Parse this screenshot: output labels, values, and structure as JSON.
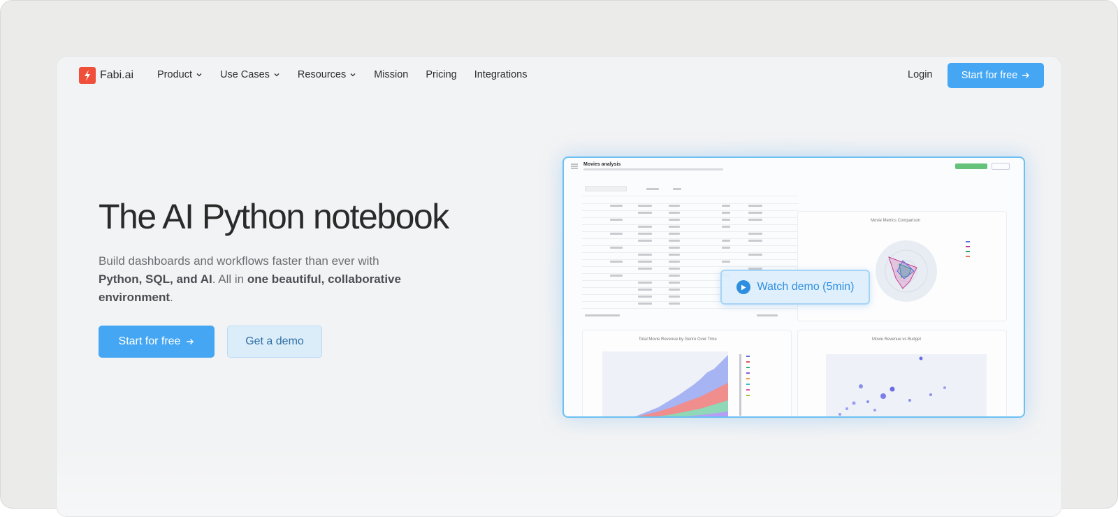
{
  "brand": {
    "name": "Fabi.ai"
  },
  "nav": {
    "items": [
      {
        "label": "Product",
        "has_dropdown": true
      },
      {
        "label": "Use Cases",
        "has_dropdown": true
      },
      {
        "label": "Resources",
        "has_dropdown": true
      },
      {
        "label": "Mission",
        "has_dropdown": false
      },
      {
        "label": "Pricing",
        "has_dropdown": false
      },
      {
        "label": "Integrations",
        "has_dropdown": false
      }
    ],
    "login": "Login",
    "cta": "Start for free"
  },
  "hero": {
    "title": "The AI Python notebook",
    "subtitle_part1": "Build dashboards and workflows faster than ever with ",
    "subtitle_bold1": "Python, SQL, and AI",
    "subtitle_part2": ". All in ",
    "subtitle_bold2": "one beautiful, collaborative environment",
    "subtitle_part3": ".",
    "primary_button": "Start for free",
    "secondary_button": "Get a demo"
  },
  "preview": {
    "notebook_title": "Movies analysis",
    "panel_radar_title": "Movie Metrics Comparison",
    "panel_bar_title": "Total Movie Revenue by Genre Over Time",
    "panel_scatter_title": "Movie Revenue vs Budget",
    "watch_demo": "Watch demo (5min)"
  },
  "colors": {
    "accent": "#45a7f3",
    "brand_red": "#f0503a",
    "demo_blue": "#2e8fe0"
  },
  "icons": [
    "logo-bolt-icon",
    "chevron-down-icon",
    "arrow-right-icon",
    "play-icon"
  ]
}
